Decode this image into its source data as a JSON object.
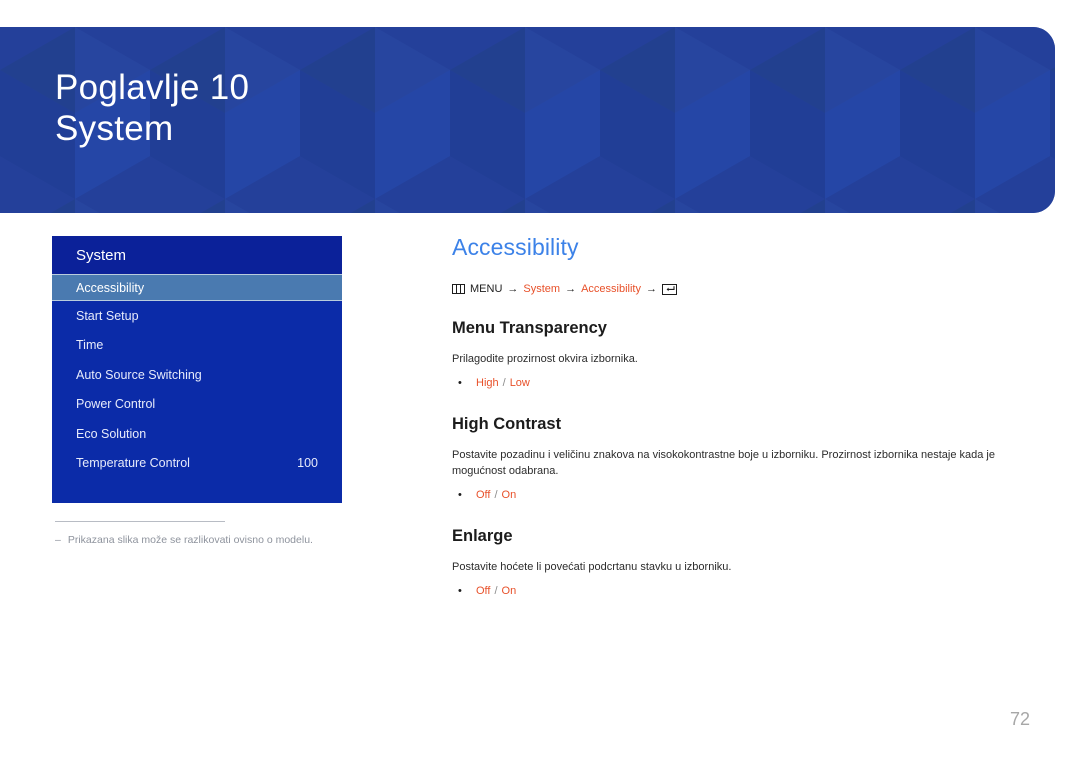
{
  "chapter": {
    "number_line": "Poglavlje 10",
    "title_line": "System",
    "banner_color": "#24409a"
  },
  "osd": {
    "header_title": "System",
    "items": [
      {
        "label": "Accessibility",
        "value": "",
        "selected": true
      },
      {
        "label": "Start Setup",
        "value": "",
        "selected": false
      },
      {
        "label": "Time",
        "value": "",
        "selected": false
      },
      {
        "label": "Auto Source Switching",
        "value": "",
        "selected": false
      },
      {
        "label": "Power Control",
        "value": "",
        "selected": false
      },
      {
        "label": "Eco Solution",
        "value": "",
        "selected": false
      },
      {
        "label": "Temperature Control",
        "value": "100",
        "selected": false
      }
    ],
    "panel_color": "#0b2ba8",
    "selected_color": "#4a7ab0"
  },
  "footnote": {
    "dash": "–",
    "text": "Prikazana slika može se razlikovati ovisno o modelu."
  },
  "content": {
    "page_title": "Accessibility",
    "title_color": "#3c82e8",
    "accent_color": "#e8512a",
    "breadcrumb": {
      "menu_icon": "menu-grid-icon",
      "menu_label": "MENU",
      "arrow": "→",
      "step1": "System",
      "step2": "Accessibility",
      "enter_icon": "enter-key-icon"
    },
    "sections": [
      {
        "heading": "Menu Transparency",
        "description": "Prilagodite prozirnost okvira izbornika.",
        "options": [
          {
            "bullet": "•",
            "value1": "High",
            "sep": "/",
            "value2": "Low"
          }
        ]
      },
      {
        "heading": "High Contrast",
        "description": "Postavite pozadinu i veličinu znakova na visokokontrastne boje u izborniku. Prozirnost izbornika nestaje kada je mogućnost odabrana.",
        "options": [
          {
            "bullet": "•",
            "value1": "Off",
            "sep": "/",
            "value2": "On"
          }
        ]
      },
      {
        "heading": "Enlarge",
        "description": "Postavite hoćete li povećati podcrtanu stavku u izborniku.",
        "options": [
          {
            "bullet": "•",
            "value1": "Off",
            "sep": "/",
            "value2": "On"
          }
        ]
      }
    ]
  },
  "page_number": "72"
}
